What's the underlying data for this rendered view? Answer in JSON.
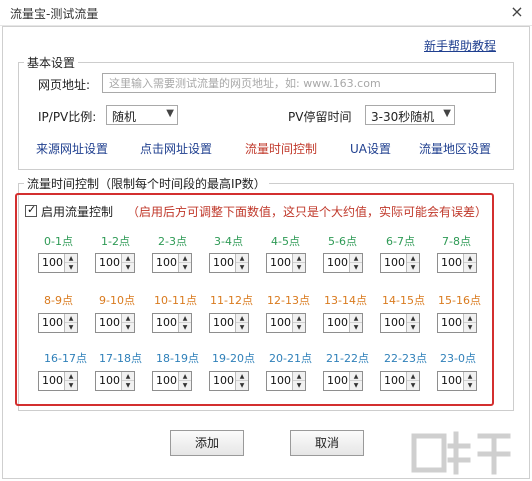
{
  "window": {
    "title": "流量宝-测试流量",
    "close_glyph": "×"
  },
  "help_link": "新手帮助教程",
  "basic": {
    "section_title": "基本设置",
    "url_label": "网页地址:",
    "url_placeholder": "这里输入需要测试流量的网页地址，如: www.163.com",
    "ippv_label": "IP/PV比例:",
    "ippv_value": "随机",
    "stay_label": "PV停留时间",
    "stay_value": "3-30秒随机"
  },
  "nav_links": [
    {
      "label": "来源网址设置",
      "active": false
    },
    {
      "label": "点击网址设置",
      "active": false
    },
    {
      "label": "流量时间控制",
      "active": true
    },
    {
      "label": "UA设置",
      "active": false
    },
    {
      "label": "流量地区设置",
      "active": false
    }
  ],
  "time_control": {
    "section_title": "流量时间控制（限制每个时间段的最高IP数）",
    "enable_label": "启用流量控制",
    "enable_checked": true,
    "note": "（启用后方可调整下面数值，这只是个大约值，实际可能会有误差）",
    "colors": {
      "row1": "#2e9a55",
      "row2": "#d97a1e",
      "row3": "#2f80b9"
    },
    "rows": [
      [
        {
          "label": "0-1点",
          "value": "100"
        },
        {
          "label": "1-2点",
          "value": "100"
        },
        {
          "label": "2-3点",
          "value": "100"
        },
        {
          "label": "3-4点",
          "value": "100"
        },
        {
          "label": "4-5点",
          "value": "100"
        },
        {
          "label": "5-6点",
          "value": "100"
        },
        {
          "label": "6-7点",
          "value": "100"
        },
        {
          "label": "7-8点",
          "value": "100"
        }
      ],
      [
        {
          "label": "8-9点",
          "value": "100"
        },
        {
          "label": "9-10点",
          "value": "100"
        },
        {
          "label": "10-11点",
          "value": "100"
        },
        {
          "label": "11-12点",
          "value": "100"
        },
        {
          "label": "12-13点",
          "value": "100"
        },
        {
          "label": "13-14点",
          "value": "100"
        },
        {
          "label": "14-15点",
          "value": "100"
        },
        {
          "label": "15-16点",
          "value": "100"
        }
      ],
      [
        {
          "label": "16-17点",
          "value": "100"
        },
        {
          "label": "17-18点",
          "value": "100"
        },
        {
          "label": "18-19点",
          "value": "100"
        },
        {
          "label": "19-20点",
          "value": "100"
        },
        {
          "label": "20-21点",
          "value": "100"
        },
        {
          "label": "21-22点",
          "value": "100"
        },
        {
          "label": "22-23点",
          "value": "100"
        },
        {
          "label": "23-0点",
          "value": "100"
        }
      ]
    ]
  },
  "buttons": {
    "add": "添加",
    "cancel": "取消"
  },
  "watermark_text": "下载吧"
}
